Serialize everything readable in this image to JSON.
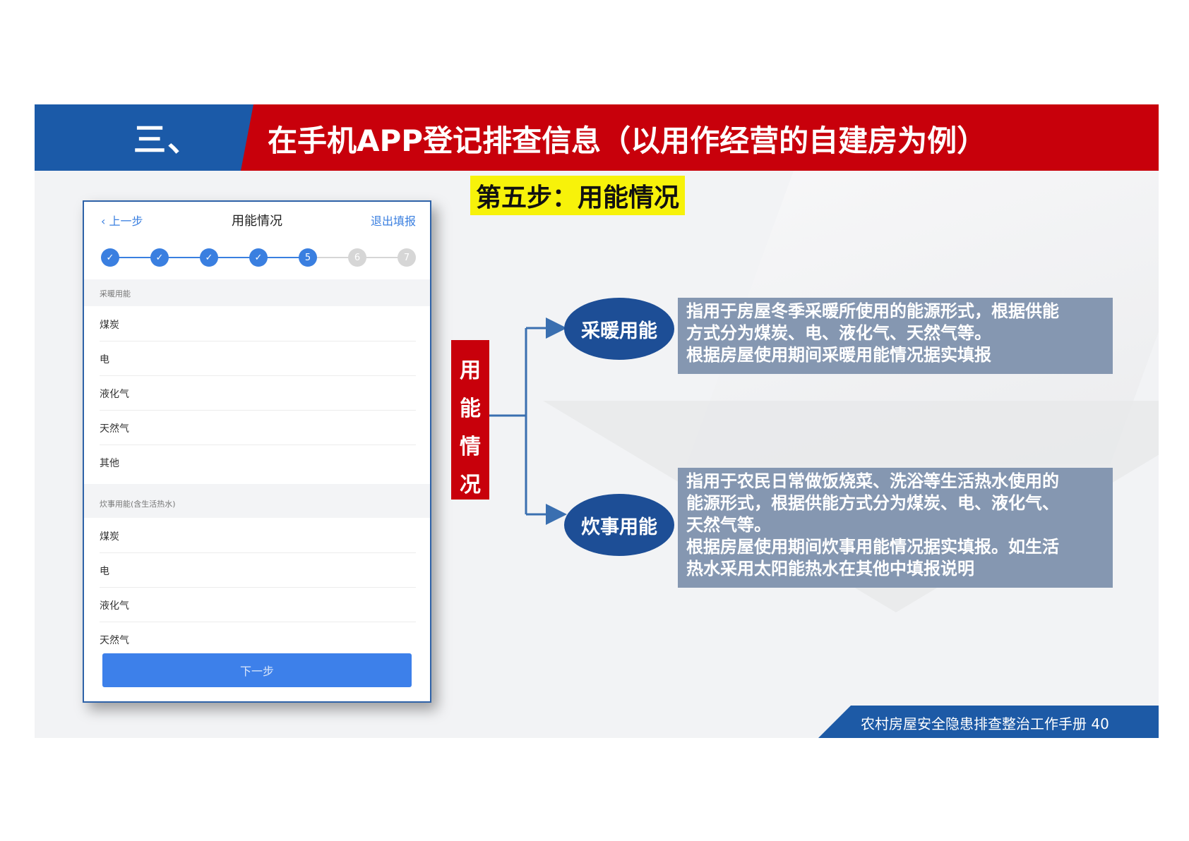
{
  "header": {
    "section_number": "三、",
    "title": "在手机APP登记排查信息（以用作经营的自建房为例）"
  },
  "phone": {
    "back_label": "上一步",
    "title": "用能情况",
    "exit_label": "退出填报",
    "steps": [
      "✓",
      "✓",
      "✓",
      "✓",
      "5",
      "6",
      "7"
    ],
    "sections": [
      {
        "header": "采暖用能",
        "items": [
          "煤炭",
          "电",
          "液化气",
          "天然气",
          "其他"
        ]
      },
      {
        "header": "炊事用能(含生活热水)",
        "items": [
          "煤炭",
          "电",
          "液化气",
          "天然气"
        ]
      }
    ],
    "next_button": "下一步"
  },
  "step_label": "第五步：用能情况",
  "root_box": [
    "用",
    "能",
    "情",
    "况"
  ],
  "branches": [
    {
      "label": "采暖用能",
      "description": [
        "指用于房屋冬季采暖所使用的能源形式，根据供能",
        "方式分为煤炭、电、液化气、天然气等。",
        "根据房屋使用期间采暖用能情况据实填报"
      ]
    },
    {
      "label": "炊事用能",
      "description": [
        "指用于农民日常做饭烧菜、洗浴等生活热水使用的",
        "能源形式，根据供能方式分为煤炭、电、液化气、",
        "天然气等。",
        "根据房屋使用期间炊事用能情况据实填报。如生活",
        "热水采用太阳能热水在其他中填报说明"
      ]
    }
  ],
  "footer": "农村房屋安全隐患排查整治工作手册 40",
  "colors": {
    "header_blue": "#1b5aa8",
    "header_red": "#c8000b",
    "accent_blue": "#3a7fe0",
    "highlight": "#f7f20a",
    "desc_bg": "#8597b1"
  }
}
